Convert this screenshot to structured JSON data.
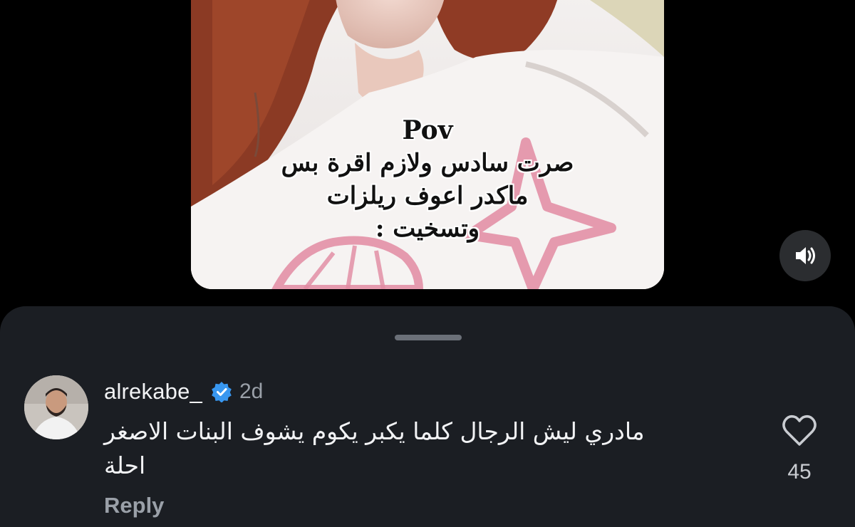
{
  "video": {
    "overlay_lines": [
      "Pov",
      "صرت سادس ولازم اقرة بس",
      "ماكدر اعوف ريلزات",
      "وتسخيت :"
    ]
  },
  "controls": {
    "sound_icon": "speaker-volume-icon"
  },
  "comment": {
    "username": "alrekabe_",
    "verified": true,
    "time": "2d",
    "text_line1": "مادري ليش الرجال كلما يكبر يكوم يشوف البنات الاصغر",
    "text_line2": "احلة",
    "reply_label": "Reply",
    "like_count": "45",
    "like_icon": "heart-outline-icon"
  },
  "colors": {
    "sheet_bg": "#1b1e23",
    "verified_blue": "#3897f0",
    "muted_text": "#9aa0a8"
  }
}
